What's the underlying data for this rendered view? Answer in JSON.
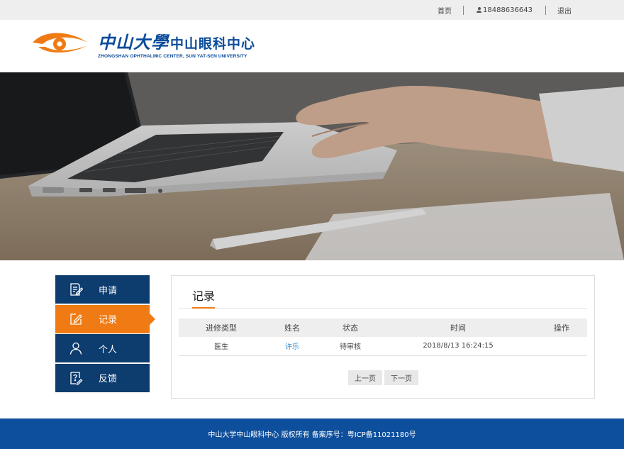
{
  "topbar": {
    "home": "首页",
    "phone": "18488636643",
    "logout": "退出"
  },
  "logo": {
    "cn_university": "中山大學",
    "cn_center": "中山眼科中心",
    "en": "ZHONGSHAN OPHTHALMIC CENTER, SUN YAT-SEN UNIVERSITY",
    "colors": {
      "orange": "#f07b14",
      "blue": "#0b4c9a"
    }
  },
  "sidebar": {
    "items": [
      {
        "label": "申请",
        "icon": "edit-form-icon",
        "active": false
      },
      {
        "label": "记录",
        "icon": "pencil-square-icon",
        "active": true
      },
      {
        "label": "个人",
        "icon": "user-icon",
        "active": false
      },
      {
        "label": "反馈",
        "icon": "question-icon",
        "active": false
      }
    ],
    "colors": {
      "normal": "#0d3c6e",
      "active": "#f07b14"
    }
  },
  "panel": {
    "title": "记录",
    "table": {
      "headers": [
        "进修类型",
        "姓名",
        "状态",
        "时间",
        "操作"
      ],
      "rows": [
        {
          "type": "医生",
          "name": "许乐",
          "status": "待审核",
          "time": "2018/8/13 16:24:15",
          "action": ""
        }
      ]
    },
    "pager": {
      "prev": "上一页",
      "next": "下一页"
    }
  },
  "footer": {
    "text": "中山大学中山眼科中心 版权所有 备案序号：粤ICP备11021180号"
  }
}
